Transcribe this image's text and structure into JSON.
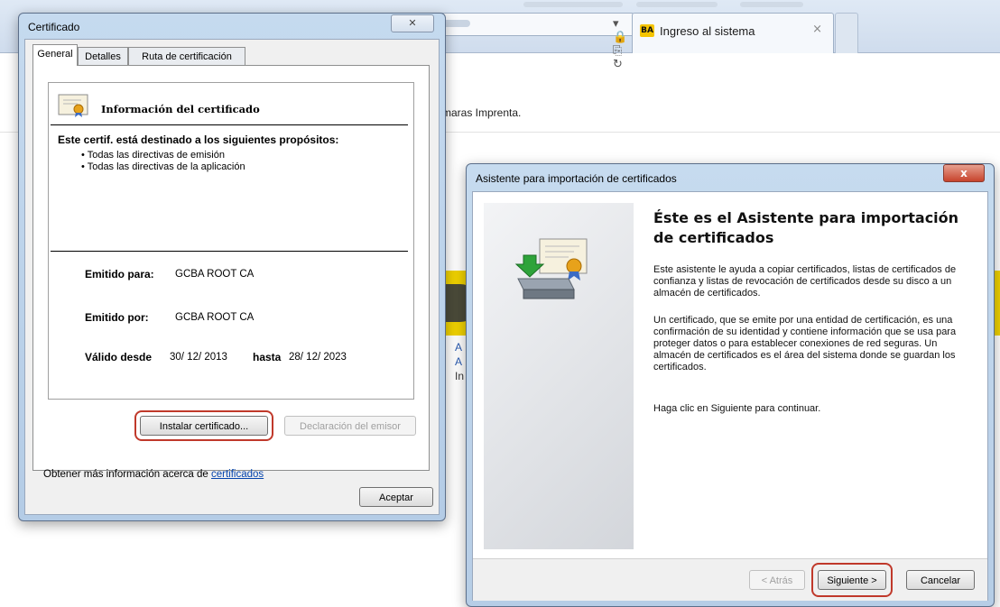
{
  "browser": {
    "tab_title": "Ingreso al sistema",
    "tab_favicon": "BA",
    "tab_close": "×",
    "addr_tools": "▾ 🔒 ⎘ ↻",
    "favorites_text": "maras Imprenta.",
    "page_fragments": [
      "A",
      "A",
      "In"
    ]
  },
  "cert_dialog": {
    "title": "Certificado",
    "close_glyph": "✕",
    "tabs": [
      "General",
      "Detalles",
      "Ruta de certificación"
    ],
    "info_title": "Información del certificado",
    "purpose_heading": "Este certif. está destinado a los siguientes propósitos:",
    "purposes": [
      "• Todas las directivas de emisión",
      "• Todas las directivas de la aplicación"
    ],
    "issued_to_label": "Emitido para:",
    "issued_to_value": "GCBA ROOT CA",
    "issued_by_label": "Emitido por:",
    "issued_by_value": "GCBA ROOT CA",
    "valid_from_label": "Válido desde",
    "valid_from_value": "30/ 12/ 2013",
    "valid_to_label": "hasta",
    "valid_to_value": "28/ 12/ 2023",
    "install_button": "Instalar certificado...",
    "issuer_statement_button": "Declaración del emisor",
    "more_info_prefix": "Obtener más información acerca de ",
    "more_info_link": "certificados",
    "ok_button": "Aceptar"
  },
  "wizard": {
    "title": "Asistente para importación de certificados",
    "close_glyph": "x",
    "heading": "Éste es el Asistente para importación de certificados",
    "paragraph1": "Este asistente le ayuda a copiar certificados, listas de certificados de confianza y listas de revocación de certificados desde su disco a un almacén de certificados.",
    "paragraph2": "Un certificado, que se emite por una entidad de certificación, es una confirmación de su identidad y contiene información que se usa para proteger datos o para establecer conexiones de red seguras. Un almacén de certificados es el área del sistema donde se guardan los certificados.",
    "paragraph3": "Haga clic en Siguiente para continuar.",
    "back_button": "< Atrás",
    "next_button": "Siguiente >",
    "cancel_button": "Cancelar"
  },
  "colors": {
    "highlight": "#c0392b",
    "link": "#0645ad",
    "banner": "#f0d200"
  }
}
